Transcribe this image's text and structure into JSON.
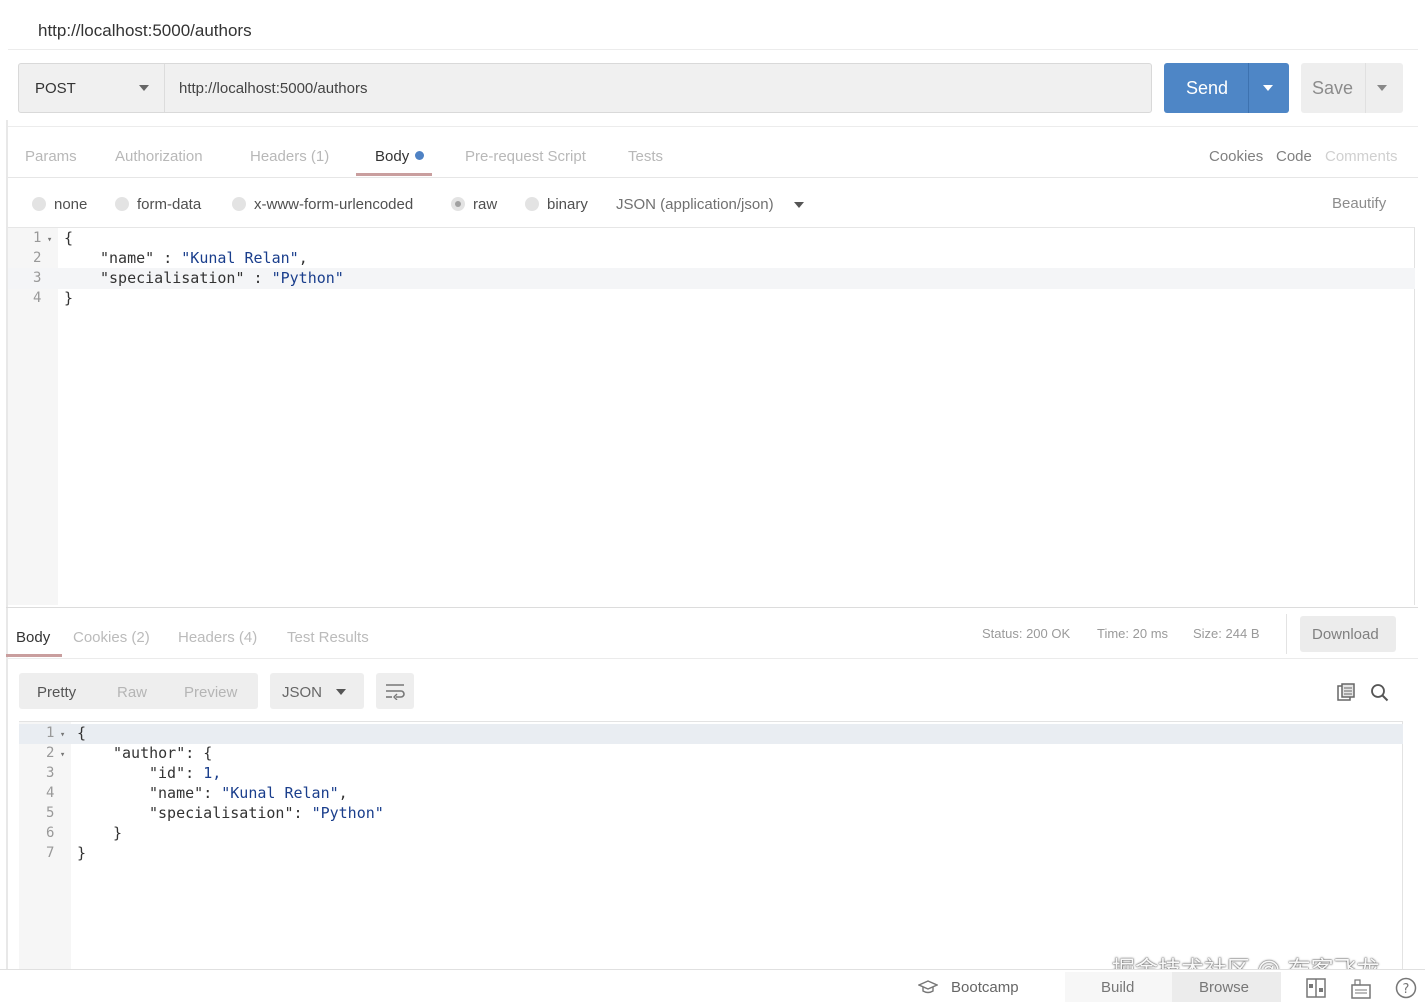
{
  "tab_title": "http://localhost:5000/authors",
  "request": {
    "method": "POST",
    "url": "http://localhost:5000/authors",
    "send_label": "Send",
    "save_label": "Save"
  },
  "request_tabs": {
    "params": "Params",
    "authorization": "Authorization",
    "headers": "Headers (1)",
    "body": "Body",
    "prerequest": "Pre-request Script",
    "tests": "Tests",
    "cookies": "Cookies",
    "code": "Code",
    "comments": "Comments"
  },
  "body_types": {
    "none": "none",
    "form_data": "form-data",
    "urlencoded": "x-www-form-urlencoded",
    "raw": "raw",
    "binary": "binary",
    "content_type": "JSON (application/json)",
    "selected": "raw",
    "beautify": "Beautify"
  },
  "request_body": {
    "ln1": "1",
    "ln2": "2",
    "ln3": "3",
    "ln4": "4",
    "open": "{",
    "name_key": "\"name\"",
    "name_val": "\"Kunal Relan\"",
    "spec_key": "\"specialisation\"",
    "spec_val": "\"Python\"",
    "close": "}"
  },
  "response_tabs": {
    "body": "Body",
    "cookies": "Cookies (2)",
    "headers": "Headers (4)",
    "test_results": "Test Results"
  },
  "response_meta": {
    "status": "Status: 200 OK",
    "time": "Time: 20 ms",
    "size": "Size: 244 B",
    "download": "Download"
  },
  "response_toolbar": {
    "pretty": "Pretty",
    "raw": "Raw",
    "preview": "Preview",
    "format": "JSON"
  },
  "response_body": {
    "ln1": "1",
    "ln2": "2",
    "ln3": "3",
    "ln4": "4",
    "ln5": "5",
    "ln6": "6",
    "ln7": "7",
    "open": "{",
    "author_key": "\"author\"",
    "id_key": "\"id\"",
    "id_val": "1,",
    "name_key": "\"name\"",
    "name_val": "\"Kunal Relan\"",
    "spec_key": "\"specialisation\"",
    "spec_val": "\"Python\"",
    "inner_close": "}",
    "close": "}"
  },
  "footer": {
    "bootcamp": "Bootcamp",
    "build": "Build",
    "browse": "Browse"
  },
  "watermark": "掘金技术社区 @ 布客飞龙"
}
